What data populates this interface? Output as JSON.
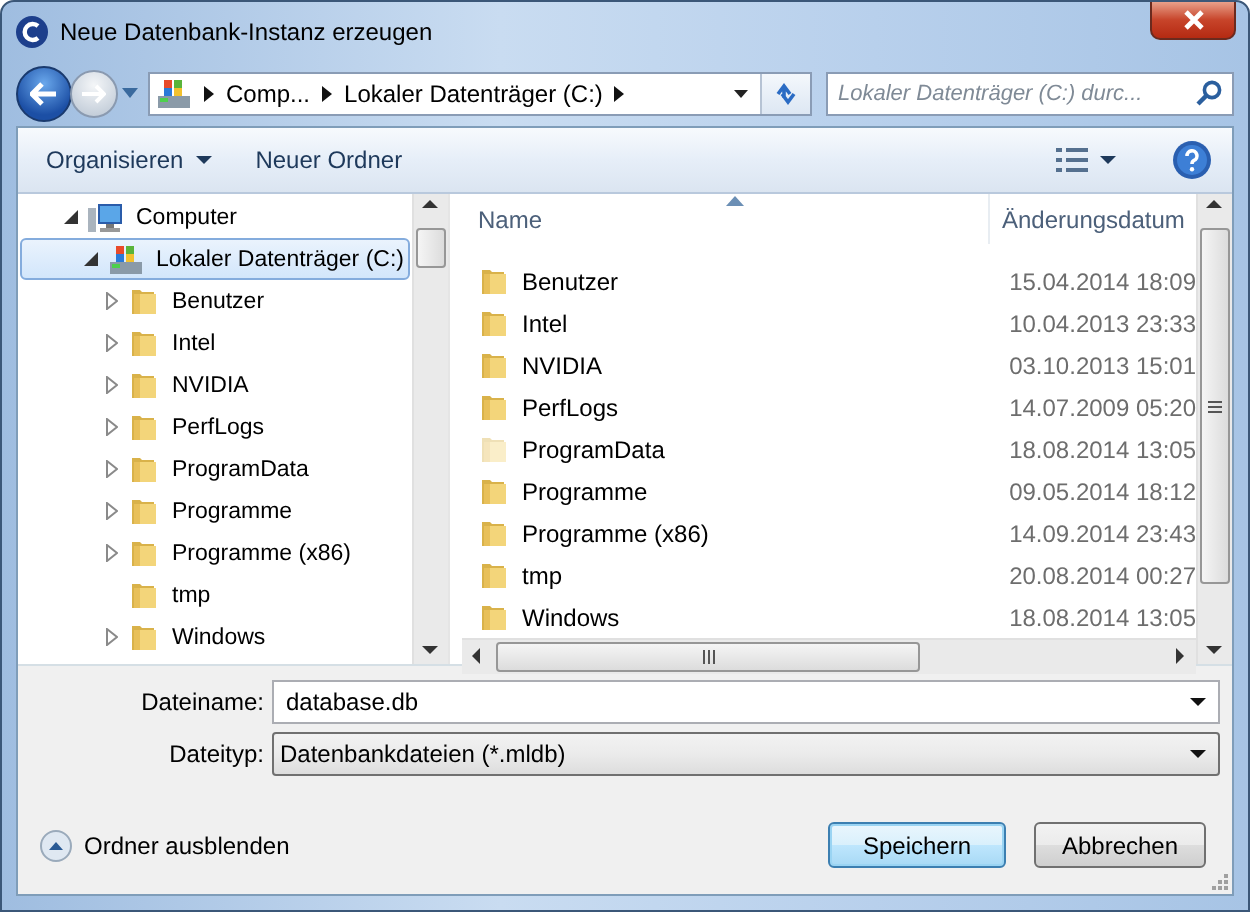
{
  "window": {
    "title": "Neue Datenbank-Instanz erzeugen"
  },
  "breadcrumb": [
    "Comp...",
    "Lokaler Datenträger (C:)"
  ],
  "search": {
    "placeholder": "Lokaler Datenträger (C:) durc..."
  },
  "toolbar": {
    "organize": "Organisieren",
    "new_folder": "Neuer Ordner"
  },
  "tree": [
    {
      "label": "Computer",
      "kind": "computer",
      "expanded": true,
      "has_children": true,
      "selected": false,
      "children": [
        {
          "label": "Lokaler Datenträger (C:)",
          "kind": "drive",
          "expanded": true,
          "has_children": true,
          "selected": true,
          "children": [
            {
              "label": "Benutzer",
              "kind": "folder",
              "expanded": false,
              "has_children": true,
              "selected": false
            },
            {
              "label": "Intel",
              "kind": "folder",
              "expanded": false,
              "has_children": true,
              "selected": false
            },
            {
              "label": "NVIDIA",
              "kind": "folder",
              "expanded": false,
              "has_children": true,
              "selected": false
            },
            {
              "label": "PerfLogs",
              "kind": "folder",
              "expanded": false,
              "has_children": true,
              "selected": false
            },
            {
              "label": "ProgramData",
              "kind": "folder",
              "expanded": false,
              "has_children": true,
              "selected": false
            },
            {
              "label": "Programme",
              "kind": "folder",
              "expanded": false,
              "has_children": true,
              "selected": false
            },
            {
              "label": "Programme (x86)",
              "kind": "folder",
              "expanded": false,
              "has_children": true,
              "selected": false
            },
            {
              "label": "tmp",
              "kind": "folder",
              "expanded": false,
              "has_children": false,
              "selected": false
            },
            {
              "label": "Windows",
              "kind": "folder",
              "expanded": false,
              "has_children": true,
              "selected": false
            }
          ]
        }
      ]
    }
  ],
  "columns": [
    {
      "label": "Name",
      "sorted": true
    },
    {
      "label": "Änderungsdatum",
      "sorted": false
    }
  ],
  "files": [
    {
      "name": "Benutzer",
      "modified": "15.04.2014 18:09",
      "hidden": false
    },
    {
      "name": "Intel",
      "modified": "10.04.2013 23:33",
      "hidden": false
    },
    {
      "name": "NVIDIA",
      "modified": "03.10.2013 15:01",
      "hidden": false
    },
    {
      "name": "PerfLogs",
      "modified": "14.07.2009 05:20",
      "hidden": false
    },
    {
      "name": "ProgramData",
      "modified": "18.08.2014 13:05",
      "hidden": true
    },
    {
      "name": "Programme",
      "modified": "09.05.2014 18:12",
      "hidden": false
    },
    {
      "name": "Programme (x86)",
      "modified": "14.09.2014 23:43",
      "hidden": false
    },
    {
      "name": "tmp",
      "modified": "20.08.2014 00:27",
      "hidden": false
    },
    {
      "name": "Windows",
      "modified": "18.08.2014 13:05",
      "hidden": false
    }
  ],
  "filename": {
    "label": "Dateiname:",
    "value": "database.db"
  },
  "filetype": {
    "label": "Dateityp:",
    "value": "Datenbankdateien (*.mldb)"
  },
  "hide_folders": "Ordner ausblenden",
  "buttons": [
    {
      "label": "Speichern",
      "default": true
    },
    {
      "label": "Abbrechen",
      "default": false
    }
  ]
}
